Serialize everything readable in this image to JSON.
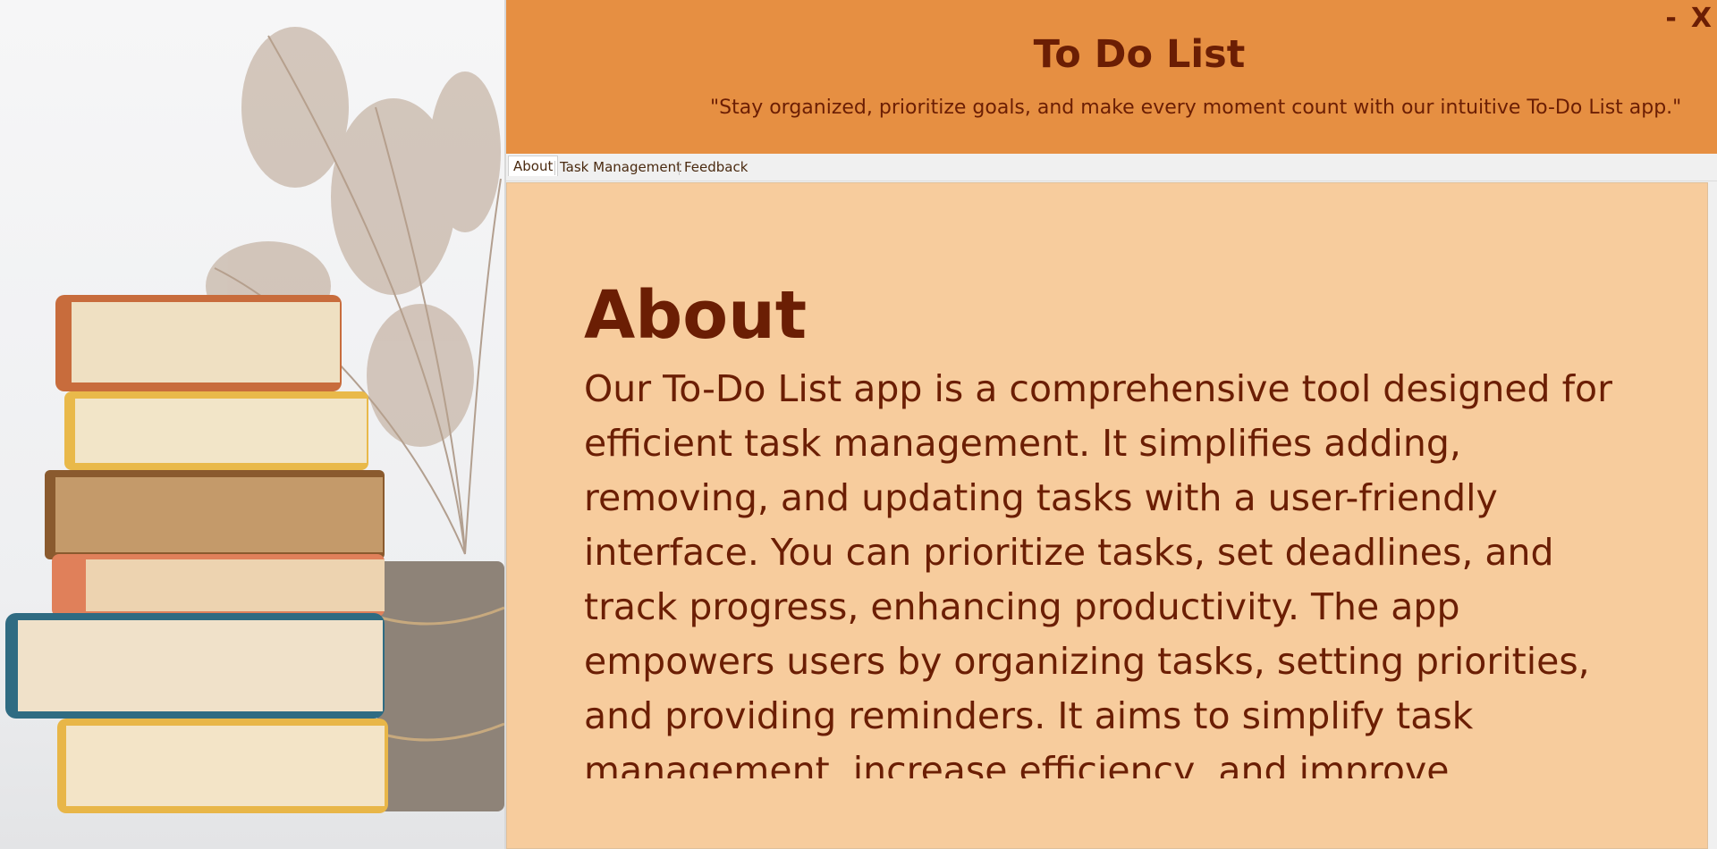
{
  "window": {
    "minimize_label": "-",
    "close_label": "X"
  },
  "header": {
    "title": "To Do List",
    "tagline": "\"Stay organized, prioritize goals, and make every moment count with our intuitive To-Do List app.\""
  },
  "tabs": [
    {
      "label": "About",
      "active": true
    },
    {
      "label": "Task Management",
      "active": false
    },
    {
      "label": "Feedback",
      "active": false
    }
  ],
  "about": {
    "heading": "About",
    "body": "Our To-Do List app is a comprehensive tool designed for efficient task management. It simplifies adding, removing, and updating tasks with a user-friendly interface. You can prioritize tasks, set deadlines, and track progress, enhancing productivity. The app empowers users by organizing tasks, setting priorities, and providing reminders. It aims to simplify task management, increase efficiency, and improve productivity for users."
  },
  "colors": {
    "header_bg": "#e68f42",
    "content_bg": "#f7cc9d",
    "text": "#6b1e04"
  }
}
